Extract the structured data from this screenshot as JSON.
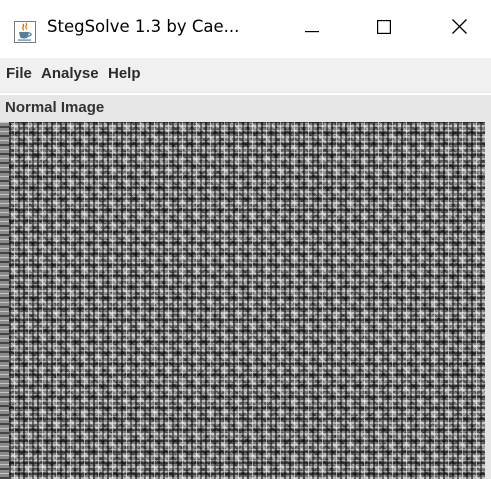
{
  "window": {
    "title": "StegSolve 1.3 by Cae...",
    "icon": "java-cup-icon",
    "controls": {
      "minimize_icon": "minimize-icon",
      "maximize_icon": "maximize-icon",
      "close_icon": "close-icon"
    }
  },
  "menubar": {
    "items": [
      {
        "label": "File"
      },
      {
        "label": "Analyse"
      },
      {
        "label": "Help"
      }
    ]
  },
  "panel": {
    "label": "Normal Image"
  },
  "colors": {
    "menubar_bg": "#f0f0f0",
    "panel_bg": "#e6e6e6",
    "titlebar_bg": "#ffffff",
    "java_icon_blue": "#5382a1",
    "java_icon_orange": "#e76f00"
  }
}
